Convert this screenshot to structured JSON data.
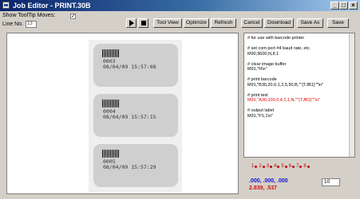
{
  "window": {
    "title": "Job Editor - PRINT.30B",
    "minimize": "_",
    "maximize": "□",
    "close": "×"
  },
  "options": {
    "show_tooltip_label": "Show ToolTip Moves:",
    "show_tooltip_checked": "✓",
    "line_no_label": "Line No.",
    "line_no_value": "13"
  },
  "toolbar": {
    "buttons": [
      "Tool View",
      "Optimize",
      "Refresh",
      "Cancel",
      "Download",
      "Save As",
      "Save"
    ]
  },
  "labels": [
    {
      "number": "0003",
      "timestamp": "08/04/09 15:57:08"
    },
    {
      "number": "0004",
      "timestamp": "08/04/09 15:57:15"
    },
    {
      "number": "0005",
      "timestamp": "08/04/09 15:57:29"
    }
  ],
  "code": [
    {
      "text": "# for use with barcode printer",
      "red": false
    },
    {
      "text": "",
      "red": false
    },
    {
      "text": "# set com port #4 baud rate, etc.",
      "red": false
    },
    {
      "text": "M90,9600,N,8,1",
      "red": false
    },
    {
      "text": "",
      "red": false
    },
    {
      "text": "# clear image buffer",
      "red": false
    },
    {
      "text": "M91,\"N\\n\"",
      "red": false
    },
    {
      "text": "",
      "red": false
    },
    {
      "text": "# print barcode",
      "red": false
    },
    {
      "text": "M91,\"B30,20,0,1,2,5,50,B,\"\"{TJB1}\"\"\\n\"",
      "red": false
    },
    {
      "text": "",
      "red": false
    },
    {
      "text": "# print text",
      "red": false
    },
    {
      "text": "M91,\"A30,100,0,4,1,1,N,\"\"{TJB2}\"\"\\n\"",
      "red": true
    },
    {
      "text": "",
      "red": false
    },
    {
      "text": "# output label",
      "red": false
    },
    {
      "text": "M91,\"P1,1\\n\"",
      "red": false
    }
  ],
  "ports": [
    "1",
    "2",
    "3",
    "4",
    "5",
    "6",
    "7",
    "8"
  ],
  "status": {
    "coords": ".000, .000, .000",
    "position": "2.839, .537",
    "zoom": "10"
  },
  "colors": {
    "titlebar": "#0a246a",
    "highlight_code": "#e00000",
    "coord_blue": "#1010d8",
    "coord_red": "#d01010"
  }
}
